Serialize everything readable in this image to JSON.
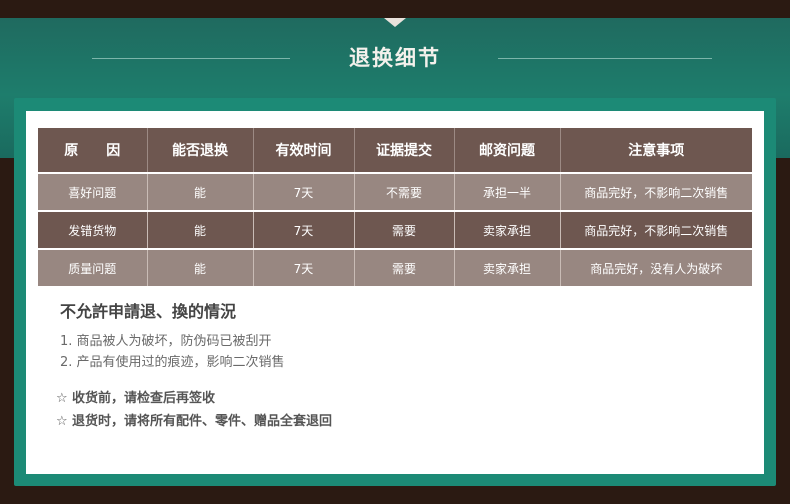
{
  "header": {
    "title": "退换细节"
  },
  "table": {
    "headers": [
      "原　　因",
      "能否退换",
      "有效时间",
      "证据提交",
      "邮资问题",
      "注意事项"
    ],
    "rows": [
      [
        "喜好问题",
        "能",
        "7天",
        "不需要",
        "承担一半",
        "商品完好，不影响二次销售"
      ],
      [
        "发错货物",
        "能",
        "7天",
        "需要",
        "卖家承担",
        "商品完好，不影响二次销售"
      ],
      [
        "质量问题",
        "能",
        "7天",
        "需要",
        "卖家承担",
        "商品完好，没有人为破坏"
      ]
    ]
  },
  "conditions": {
    "title": "不允許申請退、換的情況",
    "items": [
      "1. 商品被人为破坏，防伪码已被刮开",
      "2. 产品有使用过的痕迹，影响二次销售"
    ]
  },
  "notes": {
    "star_icon": "☆",
    "items": [
      "收货前，请检查后再签收",
      "退货时，请将所有配件、零件、赠品全套退回"
    ]
  },
  "colors": {
    "header_band": "#1e7d6c",
    "frame": "#1c8a76",
    "table_dark": "#6e5750",
    "table_light": "#988781",
    "background": "#2b1a12"
  }
}
